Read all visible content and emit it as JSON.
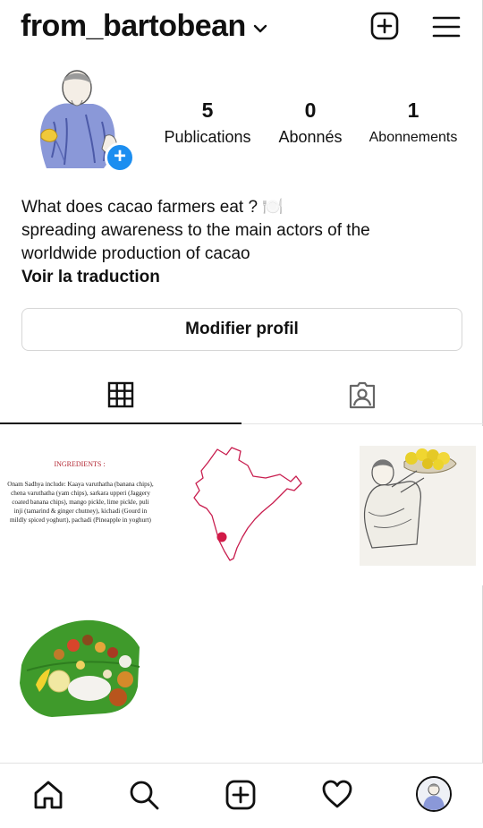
{
  "header": {
    "username": "from_bartobean",
    "icons": {
      "dropdown": "chevron-down-icon",
      "new_post": "plus-square-icon",
      "menu": "hamburger-menu-icon"
    }
  },
  "profile": {
    "avatar_icon": "avatar-drawing-icon",
    "add_story_icon": "plus-circle-icon",
    "stats": {
      "posts": {
        "value": "5",
        "label": "Publications"
      },
      "followers": {
        "value": "0",
        "label": "Abonnés"
      },
      "following": {
        "value": "1",
        "label": "Abonnements"
      }
    },
    "bio": {
      "line1": "What does cacao farmers eat ? 🍽️",
      "line2": "spreading awareness to the main actors of the",
      "line3": "worldwide production of cacao",
      "translate": "Voir la traduction"
    },
    "edit_button": "Modifier profil"
  },
  "tabs": [
    {
      "name": "grid",
      "icon": "grid-icon",
      "active": true
    },
    {
      "name": "tagged",
      "icon": "tagged-person-icon",
      "active": false
    }
  ],
  "posts": {
    "ingredients": {
      "title": "INGREDIENTS :",
      "text": "Onam Sadhya include: Kaaya varuthatha (banana chips), chena varuthatha (yam chips), sarkara upperi (Jaggery coated banana chips), mango pickle, lime pickle, puli inji (tamarind & ginger chutney), kichadi (Gourd in mildly spiced yoghurt), pachadi (Pineapple in yoghurt)"
    },
    "images": [
      "india-map-image",
      "woman-carrying-fruit-basket-image",
      "banana-leaf-meal-image"
    ]
  },
  "bottom_nav": {
    "icons": [
      "home-icon",
      "search-icon",
      "add-post-icon",
      "heart-icon",
      "profile-avatar-icon"
    ]
  },
  "colors": {
    "accent_blue": "#1c8ef0",
    "map_dot": "#d11a47",
    "ingredients_title": "#b32632"
  }
}
